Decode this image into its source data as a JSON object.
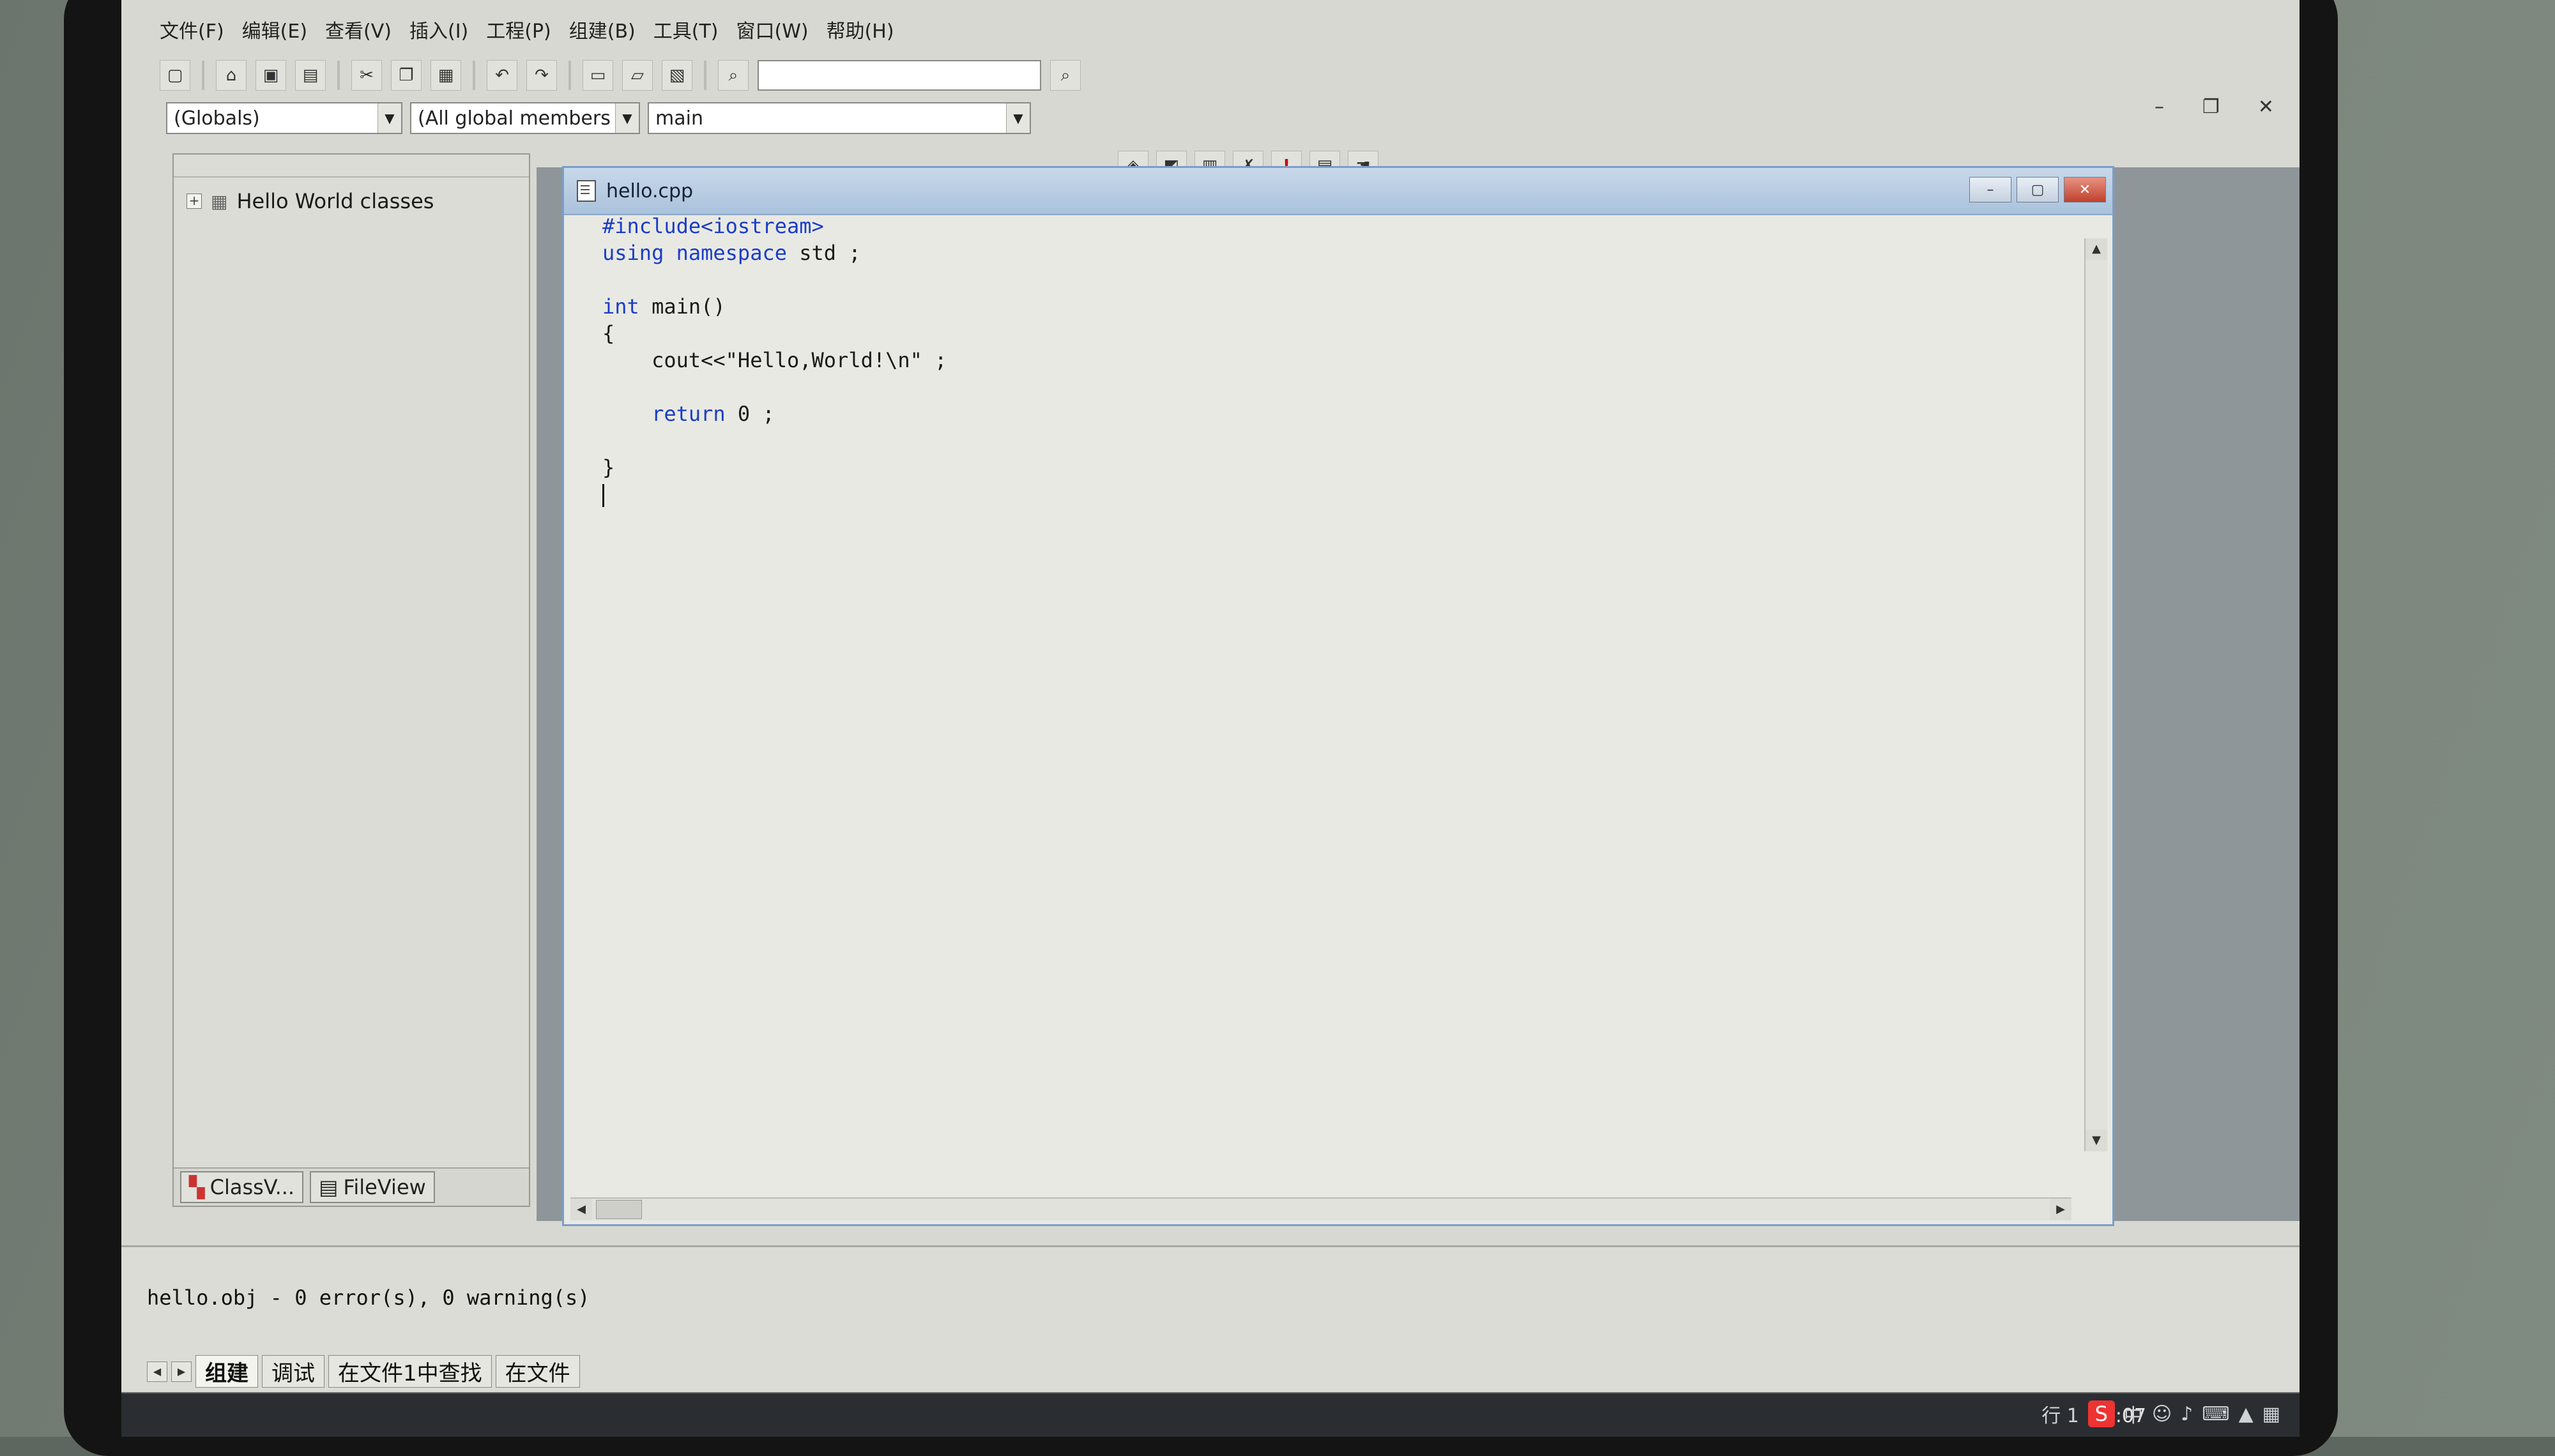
{
  "menu": {
    "items": [
      "文件(F)",
      "编辑(E)",
      "查看(V)",
      "插入(I)",
      "工程(P)",
      "组建(B)",
      "工具(T)",
      "窗口(W)",
      "帮助(H)"
    ]
  },
  "combos": {
    "scope": "(Globals)",
    "members": "(All global members",
    "function": "main"
  },
  "workspace": {
    "tree_root": "Hello World classes",
    "tabs": [
      "ClassV...",
      "FileView"
    ]
  },
  "editor": {
    "filename": "hello.cpp",
    "lines": [
      "#include<iostream>",
      "using namespace std ;",
      "",
      "int main()",
      "{",
      "    cout<<\"Hello,World!\\n\" ;",
      "",
      "    return 0 ;",
      "",
      "}"
    ]
  },
  "output": {
    "message": "hello.obj - 0 error(s), 0 warning(s)",
    "tabs": [
      "组建",
      "调试",
      "在文件1中查找",
      "在文件"
    ]
  },
  "statusbar": {
    "line_prefix": "行 1",
    "clock": "22:07",
    "ime": "中"
  }
}
